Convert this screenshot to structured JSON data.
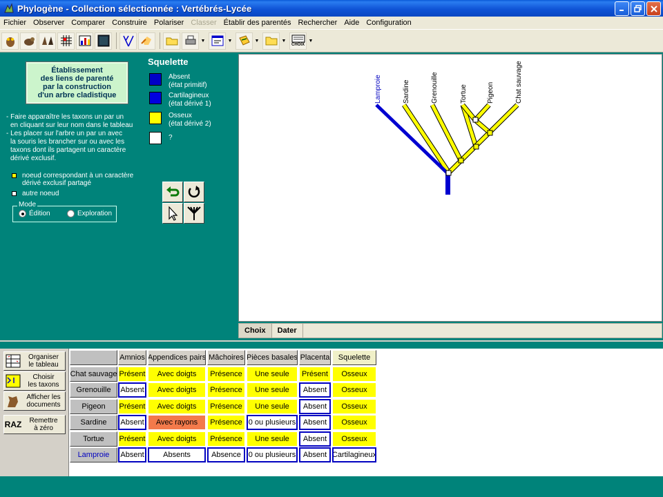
{
  "window": {
    "title": "Phylogène - Collection sélectionnée : Vertébrés-Lycée"
  },
  "menu": [
    "Fichier",
    "Observer",
    "Comparer",
    "Construire",
    "Polariser",
    "Classer",
    "Établir des parentés",
    "Rechercher",
    "Aide",
    "Configuration"
  ],
  "menu_disabled": [
    "Classer"
  ],
  "toolbar": {
    "icons": [
      "owl-icon",
      "rodent-icon",
      "bird-pair-icon",
      "grid-icon",
      "chart-icon",
      "screen-icon",
      "branch-icon",
      "hand-pointer-icon",
      "folder-open-icon",
      "printer-icon",
      "window-list-icon",
      "documents-icon",
      "folder-icon",
      "choix-icon"
    ],
    "choix_label": "CHOIX"
  },
  "instructions": {
    "box": [
      "Établissement",
      "des liens de parenté",
      "par la construction",
      "d'un arbre cladistique"
    ],
    "steps": [
      "- Faire apparaître les taxons un par un",
      "  en cliquant sur  leur nom dans le tableau",
      "- Les placer sur l'arbre un par un avec",
      "  la souris les brancher sur ou avec les",
      "  taxons dont ils partagent un caractère",
      "  dérivé exclusif."
    ],
    "node_legend": [
      {
        "text": "noeud correspondant à un caractère",
        "text2": "dérivé exclusif partagé",
        "color": "#ffff00"
      },
      {
        "text": "autre noeud",
        "text2": "",
        "color": "#ffffff"
      }
    ],
    "mode": {
      "label": "Mode",
      "edit": "Édition",
      "explore": "Exploration",
      "selected": "Édition"
    }
  },
  "character_legend": {
    "title": "Squelette",
    "states": [
      {
        "label": "Absent",
        "sub": "(état primitif)",
        "color": "#0000c8"
      },
      {
        "label": "Cartilagineux",
        "sub": "(état dérivé 1)",
        "color": "#0000e0"
      },
      {
        "label": "Osseux",
        "sub": "(état dérivé 2)",
        "color": "#ffff00"
      },
      {
        "label": "?",
        "sub": "",
        "color": "#ffffff"
      }
    ]
  },
  "tree": {
    "taxa": [
      "Lamproie",
      "Sardine",
      "Grenouille",
      "Tortue",
      "Pigeon",
      "Chat sauvage"
    ],
    "taxa_colors": [
      "#0000c0",
      "#000000",
      "#000000",
      "#000000",
      "#000000",
      "#000000"
    ],
    "tabs": [
      "Choix",
      "Dater"
    ]
  },
  "side_buttons": [
    {
      "line1": "Organiser",
      "line2": "le tableau"
    },
    {
      "line1": "Choisir",
      "line2": "les taxons"
    },
    {
      "line1": "Afficher les",
      "line2": "documents"
    },
    {
      "line1": "Remettre",
      "line2": "à zéro",
      "icon_text": "RAZ"
    }
  ],
  "table": {
    "columns": [
      "Amnios",
      "Appendices pairs",
      "Mâchoires",
      "Pièces basales",
      "Placenta",
      "Squelette"
    ],
    "active_column": "Squelette",
    "rows": [
      {
        "taxon": "Chat sauvage",
        "values": [
          "Présent",
          "Avec doigts",
          "Présence",
          "Une seule",
          "Présent",
          "Osseux"
        ],
        "styles": [
          "y",
          "y",
          "y",
          "y",
          "y",
          "y"
        ]
      },
      {
        "taxon": "Grenouille",
        "values": [
          "Absent",
          "Avec doigts",
          "Présence",
          "Une seule",
          "Absent",
          "Osseux"
        ],
        "styles": [
          "w",
          "y",
          "y",
          "y",
          "w",
          "y"
        ]
      },
      {
        "taxon": "Pigeon",
        "values": [
          "Présent",
          "Avec doigts",
          "Présence",
          "Une seule",
          "Absent",
          "Osseux"
        ],
        "styles": [
          "y",
          "y",
          "y",
          "y",
          "w",
          "y"
        ]
      },
      {
        "taxon": "Sardine",
        "values": [
          "Absent",
          "Avec rayons",
          "Présence",
          "0 ou plusieurs",
          "Absent",
          "Osseux"
        ],
        "styles": [
          "w",
          "o",
          "y",
          "w",
          "w",
          "y"
        ]
      },
      {
        "taxon": "Tortue",
        "values": [
          "Présent",
          "Avec doigts",
          "Présence",
          "Une seule",
          "Absent",
          "Osseux"
        ],
        "styles": [
          "y",
          "y",
          "y",
          "y",
          "w",
          "y"
        ]
      },
      {
        "taxon": "Lamproie",
        "values": [
          "Absent",
          "Absents",
          "Absence",
          "0 ou plusieurs",
          "Absent",
          "Cartilagineux"
        ],
        "styles": [
          "w",
          "w",
          "w",
          "w",
          "w",
          "w"
        ]
      }
    ],
    "taxon_color_lamproie": "#0000c0"
  }
}
